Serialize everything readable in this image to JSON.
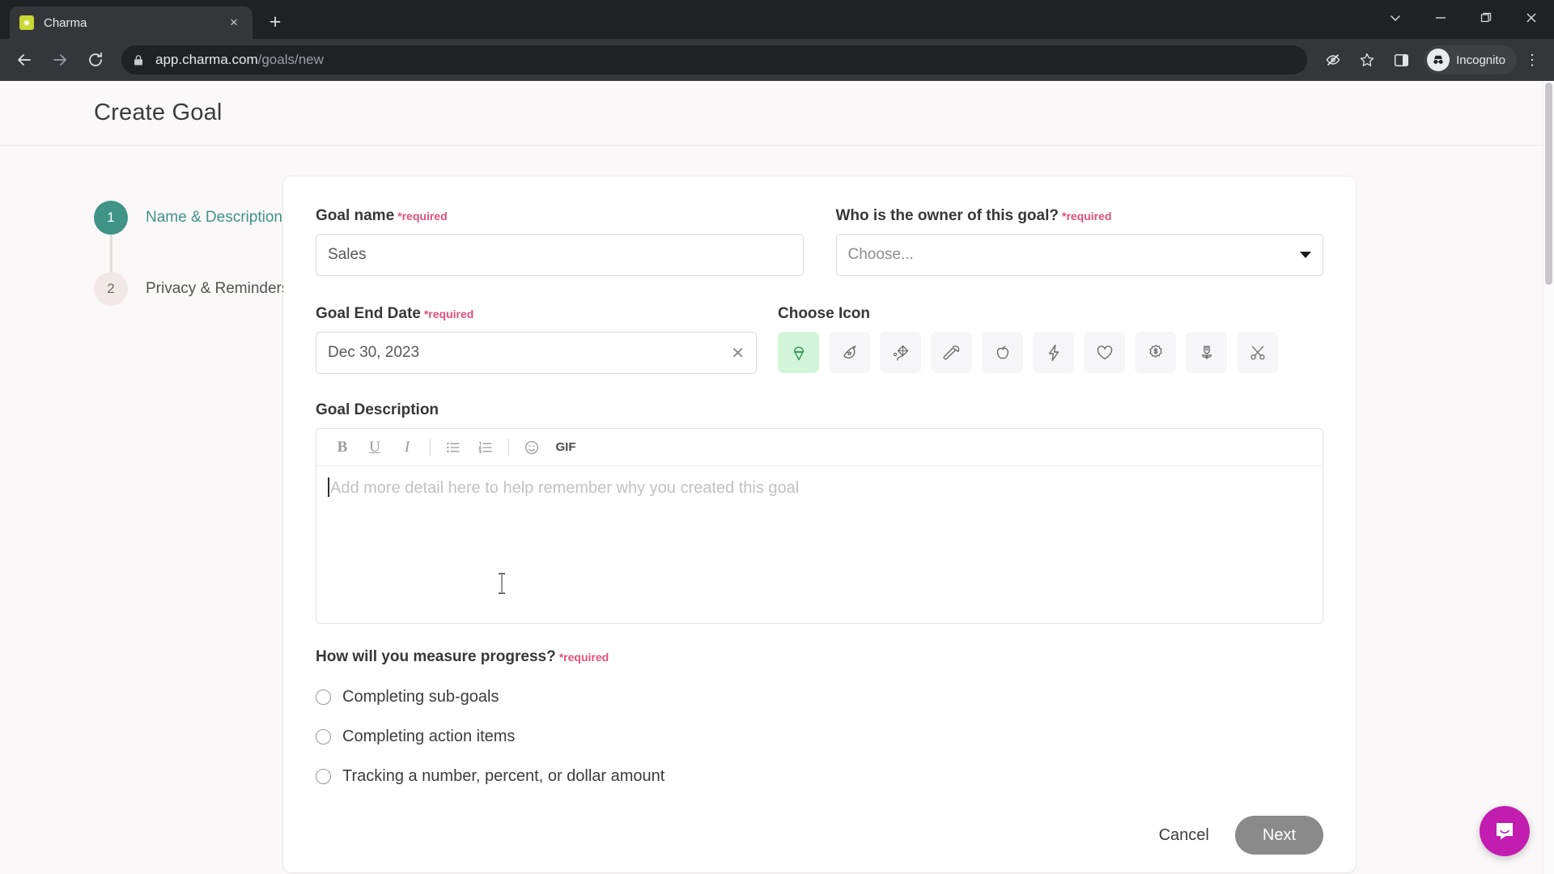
{
  "browser": {
    "tab": {
      "title": "Charma",
      "favicon": "charma-favicon",
      "close": "×"
    },
    "new_tab_label": "+",
    "window_controls": {
      "expand": "⌄",
      "minimize": "–",
      "maximize": "❐",
      "close": "✕"
    },
    "nav": {
      "back": "←",
      "forward": "→",
      "reload": "⟳"
    },
    "omnibox": {
      "lock_icon": "lock-icon",
      "url_host": "app.charma.com",
      "url_path": "/goals/new"
    },
    "toolbar_right": {
      "tracking_protection": "eye-slash-icon",
      "bookmark": "star-icon",
      "side_panel": "side-panel-icon",
      "profile_label": "Incognito",
      "menu": "⋮"
    }
  },
  "page": {
    "title": "Create Goal"
  },
  "stepper": {
    "steps": [
      {
        "number": "1",
        "label": "Name & Description",
        "state": "active"
      },
      {
        "number": "2",
        "label": "Privacy & Reminders",
        "state": "inactive"
      }
    ]
  },
  "form": {
    "required_marker": "*required",
    "goal_name": {
      "label": "Goal name",
      "value": "Sales",
      "placeholder": "Goal name"
    },
    "owner": {
      "label": "Who is the owner of this goal?",
      "value": "Choose...",
      "is_placeholder": true
    },
    "end_date": {
      "label": "Goal End Date",
      "value": "Dec 30, 2023",
      "clear_label": "✕"
    },
    "choose_icon": {
      "label": "Choose Icon",
      "selected_index": 0,
      "icons": [
        {
          "name": "ice-cream-icon",
          "selected": true
        },
        {
          "name": "comet-icon",
          "selected": false
        },
        {
          "name": "kite-icon",
          "selected": false
        },
        {
          "name": "hammer-icon",
          "selected": false
        },
        {
          "name": "apple-icon",
          "selected": false
        },
        {
          "name": "lightning-bolt-icon",
          "selected": false
        },
        {
          "name": "heart-icon",
          "selected": false
        },
        {
          "name": "dollar-badge-icon",
          "selected": false
        },
        {
          "name": "flower-icon",
          "selected": false
        },
        {
          "name": "scissors-icon",
          "selected": false
        }
      ]
    },
    "description": {
      "label": "Goal Description",
      "placeholder": "Add more detail here to help remember why you created this goal",
      "value": "",
      "toolbar": [
        {
          "name": "bold-icon",
          "label": "B"
        },
        {
          "name": "underline-icon",
          "label": "U"
        },
        {
          "name": "italic-icon",
          "label": "I"
        },
        {
          "name": "separator",
          "label": ""
        },
        {
          "name": "bulleted-list-icon",
          "label": ""
        },
        {
          "name": "numbered-list-icon",
          "label": ""
        },
        {
          "name": "separator",
          "label": ""
        },
        {
          "name": "emoji-icon",
          "label": ""
        },
        {
          "name": "gif-icon",
          "label": "GIF"
        }
      ]
    },
    "measure_progress": {
      "label": "How will you measure progress?",
      "options": [
        {
          "label": "Completing sub-goals",
          "selected": false
        },
        {
          "label": "Completing action items",
          "selected": false
        },
        {
          "label": "Tracking a number, percent, or dollar amount",
          "selected": false
        }
      ]
    }
  },
  "footer": {
    "cancel_label": "Cancel",
    "next_label": "Next"
  },
  "widgets": {
    "intercom": "intercom-messenger-icon"
  },
  "colors": {
    "accent_teal": "#3f9486",
    "required_pink": "#e1507c",
    "selected_icon_bg": "#d2f5d9",
    "intercom_magenta": "#c21cb0",
    "page_bg": "#fbf8f9",
    "next_button_bg": "#8a8a8a"
  }
}
